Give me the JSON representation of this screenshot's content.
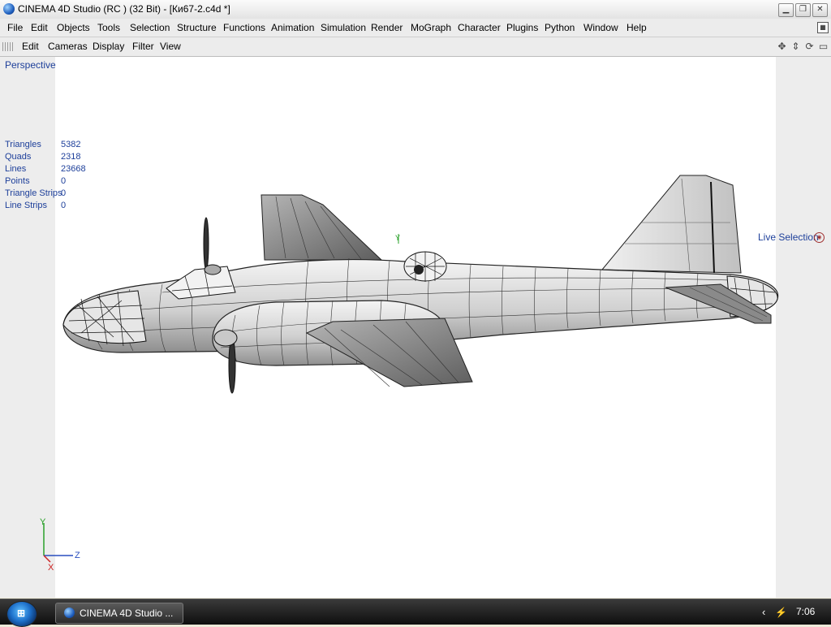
{
  "window": {
    "title": "CINEMA 4D Studio (RC ) (32 Bit) - [Ки67-2.c4d *]",
    "app_icon": "cinema4d-icon",
    "controls": {
      "minimize": "minimize-icon",
      "restore": "restore-icon",
      "close": "close-icon"
    }
  },
  "menubar": {
    "items": [
      "File",
      "Edit",
      "Objects",
      "Tools",
      "Selection",
      "Structure",
      "Functions",
      "Animation",
      "Simulation",
      "Render",
      "MoGraph",
      "Character",
      "Plugins",
      "Python",
      "Window",
      "Help"
    ]
  },
  "viewport_menubar": {
    "items": [
      "Edit",
      "Cameras",
      "Display",
      "Filter",
      "View"
    ],
    "nav_icons": [
      "move-view-icon",
      "zoom-view-icon",
      "rotate-view-icon",
      "maximize-view-icon"
    ]
  },
  "viewport": {
    "camera_label": "Perspective",
    "stats": [
      {
        "label": "Triangles",
        "value": "5382"
      },
      {
        "label": "Quads",
        "value": "2318"
      },
      {
        "label": "Lines",
        "value": "23668"
      },
      {
        "label": "Points",
        "value": "0"
      },
      {
        "label": "Triangle Strips",
        "value": "0"
      },
      {
        "label": "Line Strips",
        "value": "0"
      }
    ],
    "active_tool": "Live Selection",
    "axis_labels": {
      "y": "Y",
      "z": "Z",
      "x": "X"
    },
    "model_axis_label": "Y",
    "colors": {
      "info_text": "#1d3f9a",
      "axis_y": "#2aa02a",
      "axis_z": "#2a4fbf",
      "axis_x": "#cc2222"
    }
  },
  "taskbar": {
    "task_label": "CINEMA 4D Studio ...",
    "clock": "7:06",
    "tray_icons": [
      "show-hidden-icons-arrow",
      "network-icon"
    ]
  }
}
